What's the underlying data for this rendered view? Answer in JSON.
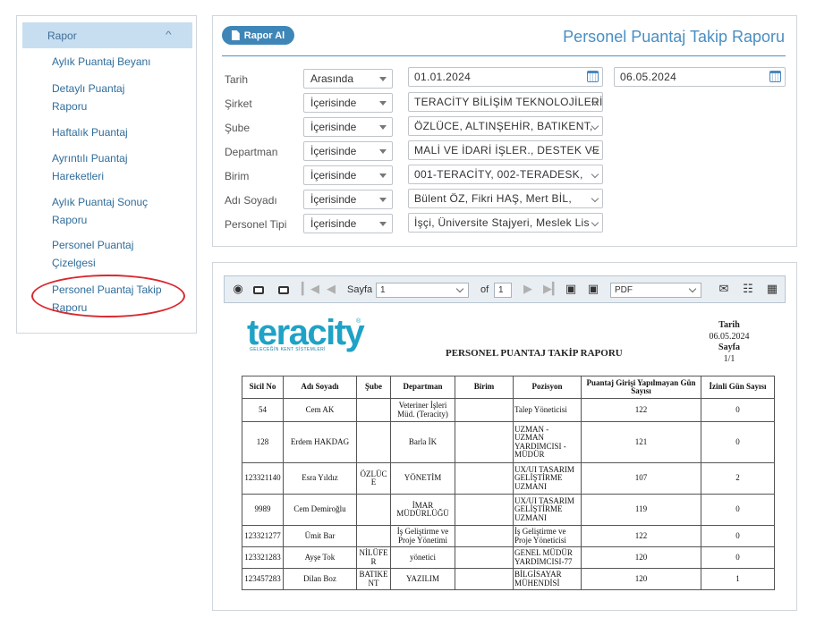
{
  "sidebar": {
    "header": "Rapor",
    "items": [
      {
        "label": "Aylık Puantaj Beyanı"
      },
      {
        "label": "Detaylı Puantaj Raporu"
      },
      {
        "label": "Haftalık Puantaj"
      },
      {
        "label": "Ayrıntılı Puantaj Hareketleri"
      },
      {
        "label": "Aylık Puantaj Sonuç Raporu"
      },
      {
        "label": "Personel Puantaj Çizelgesi"
      },
      {
        "label": "Personel Puantaj Takip Raporu"
      }
    ]
  },
  "filter": {
    "button": "Rapor Al",
    "title": "Personel Puantaj Takip Raporu",
    "rows": [
      {
        "label": "Tarih",
        "operator": "Arasında",
        "value": "01.01.2024",
        "value2": "06.05.2024"
      },
      {
        "label": "Şirket",
        "operator": "İçerisinde",
        "value": "TERACİTY BİLİŞİM TEKNOLOJİLERİ"
      },
      {
        "label": "Şube",
        "operator": "İçerisinde",
        "value": "ÖZLÜCE, ALTINŞEHİR, BATIKENT,"
      },
      {
        "label": "Departman",
        "operator": "İçerisinde",
        "value": "MALİ VE İDARİ İŞLER., DESTEK VE"
      },
      {
        "label": "Birim",
        "operator": "İçerisinde",
        "value": "001-TERACİTY, 002-TERADESK,"
      },
      {
        "label": "Adı Soyadı",
        "operator": "İçerisinde",
        "value": "Bülent ÖZ, Fikri HAŞ, Mert BİL,"
      },
      {
        "label": "Personel Tipi",
        "operator": "İçerisinde",
        "value": "İşçi, Üniversite Stajyeri, Meslek Lis"
      }
    ]
  },
  "viewer": {
    "page_label": "Sayfa",
    "page_value": "1",
    "of_label": "of",
    "of_value": "1",
    "format": "PDF"
  },
  "report": {
    "logo_text": "teracity",
    "logo_sub": "GELECEĞİN KENT SİSTEMLERİ",
    "logo_reg": "®",
    "title": "PERSONEL PUANTAJ TAKİP RAPORU",
    "date_label": "Tarih",
    "date_value": "06.05.2024",
    "page_label": "Sayfa",
    "page_value": "1/1",
    "columns": [
      "Sicil No",
      "Adı Soyadı",
      "Şube",
      "Departman",
      "Birim",
      "Pozisyon",
      "Puantaj Girişi Yapılmayan Gün Sayısı",
      "İzinli Gün Sayısı"
    ],
    "rows": [
      [
        "54",
        "Cem AK",
        "",
        "Veteriner İşleri Müd. (Teracity)",
        "",
        "Talep Yöneticisi",
        "122",
        "0"
      ],
      [
        "128",
        "Erdem HAKDAG",
        "",
        "Barla İK",
        "",
        "UZMAN - UZMAN YARDIMCISI - MÜDÜR",
        "121",
        "0"
      ],
      [
        "123321140",
        "Esra Yıldız",
        "ÖZLÜCE",
        "YÖNETİM",
        "",
        "UX/UI TASARIM GELİŞTİRME UZMANI",
        "107",
        "2"
      ],
      [
        "9989",
        "Cem Demiroğlu",
        "",
        "İMAR MÜDÜRLÜĞÜ",
        "",
        "UX/UI TASARIM GELİŞTİRME UZMANI",
        "119",
        "0"
      ],
      [
        "123321277",
        "Ümit Bar",
        "",
        "İş Geliştirme ve Proje Yönetimi",
        "",
        "İş Geliştirme ve Proje Yöneticisi",
        "122",
        "0"
      ],
      [
        "123321283",
        "Ayşe Tok",
        "NİLÜFER",
        "yönetici",
        "",
        "GENEL MÜDÜR YARDIMCISI-77",
        "120",
        "0"
      ],
      [
        "123457283",
        "Dilan Boz",
        "BATIKENT",
        "YAZILIM",
        "",
        "BİLGİSAYAR MÜHENDİSİ",
        "120",
        "1"
      ]
    ]
  }
}
